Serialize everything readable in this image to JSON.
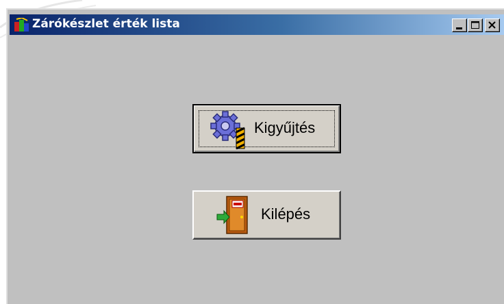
{
  "window": {
    "title": "Zárókészlet érték lista",
    "controls": {
      "minimize": "minimize",
      "maximize": "maximize",
      "close": "close"
    }
  },
  "buttons": {
    "collect": {
      "label": "Kigyűjtés",
      "icon": "gear-icon"
    },
    "exit": {
      "label": "Kilépés",
      "icon": "exit-door-icon"
    }
  },
  "colors": {
    "window_bg": "#c0c0c0",
    "titlebar_start": "#0a246a",
    "titlebar_end": "#a6caf0",
    "button_face": "#d4d0c8"
  }
}
